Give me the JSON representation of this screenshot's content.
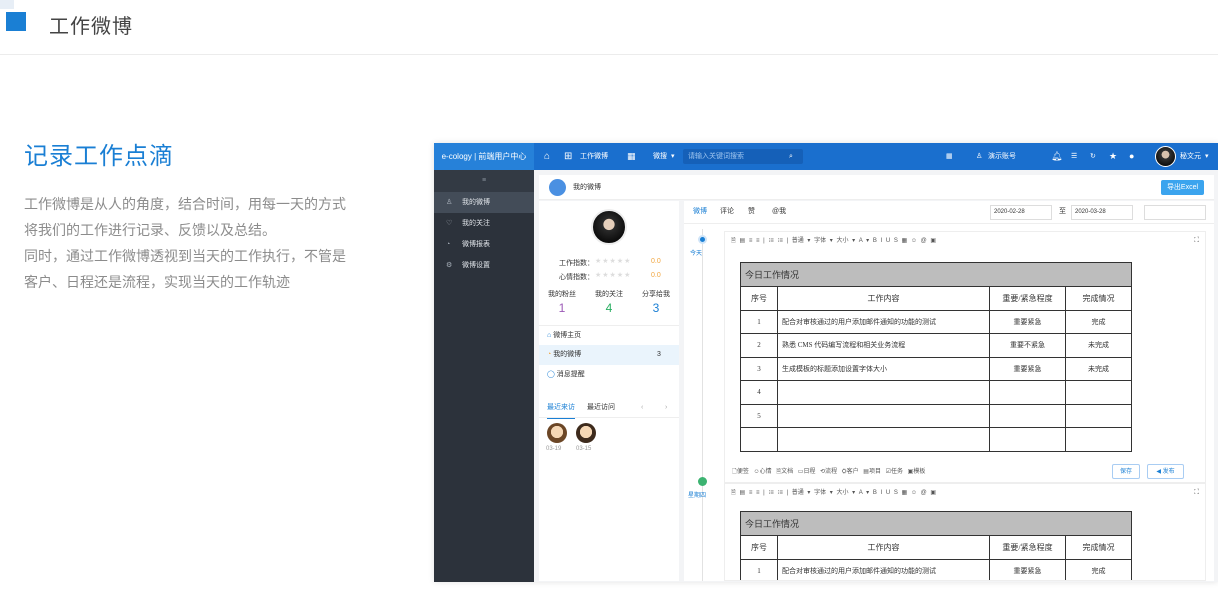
{
  "header": {
    "title": "工作微博"
  },
  "intro": {
    "heading": "记录工作点滴",
    "lines": [
      "工作微博是从人的角度，结合时间，用每一天的方式",
      "将我们的工作进行记录、反馈以及总结。",
      "同时，通过工作微博透视到当天的工作执行，不管是",
      "客户、日程还是流程，实现当天的工作轨迹"
    ]
  },
  "app": {
    "brand": "e-cology | 前端用户中心",
    "module": "工作微博",
    "search_scope": "微搜",
    "search_placeholder": "请输入关键词搜索",
    "demo_account": "演示账号",
    "user": "秘文元",
    "nav": {
      "menu_icon": "≡",
      "items": [
        "我的微博",
        "我的关注",
        "微博报表",
        "微博设置"
      ]
    },
    "page_title": "我的微博",
    "export_btn": "导出Excel",
    "profile": {
      "work_index": "工作指数：",
      "mood_index": "心情指数：",
      "stars": "★★★★★",
      "work_score": "0.0",
      "mood_score": "0.0",
      "stats": [
        {
          "label": "我的粉丝",
          "value": "1",
          "color": "#9b59b6"
        },
        {
          "label": "我的关注",
          "value": "4",
          "color": "#27ae60"
        },
        {
          "label": "分享给我",
          "value": "3",
          "color": "#1a7fd4"
        }
      ],
      "menu": [
        {
          "label": "微博主页",
          "count": ""
        },
        {
          "label": "我的微博",
          "count": "3"
        },
        {
          "label": "消息提醒",
          "count": ""
        }
      ],
      "tabs": [
        "最近来访",
        "最近访问"
      ],
      "visitors": [
        "03-19",
        "03-15"
      ]
    },
    "timeline": {
      "tabs": [
        "微博",
        "评论",
        "赞",
        "@我"
      ],
      "date_from": "2020-02-28",
      "date_to": "2020-03-28",
      "to_label": "至",
      "day1": "今天",
      "day2": "星期四"
    },
    "editor": {
      "toolbar": "🗎 ▤ ≡ ≡ | ⁝≡ ⁝≡ | 普通 ▾ 字体 ▾ 大小 ▾ A ▾ B I U S ▦ ☺ @ ▣",
      "attachments": "🗋便签 ☺心情 🗎文档 ▭日程 ⟲流程 ⛭客户 ▤项目 ☑任务 ▣模板",
      "save": "保存",
      "publish": "◀ 发布",
      "table_title": "今日工作情况",
      "columns": [
        "序号",
        "工作内容",
        "重要/紧急程度",
        "完成情况"
      ],
      "rows": [
        [
          "1",
          "配合对审核通过的用户添加邮件通知的功能的测试",
          "重要紧急",
          "完成"
        ],
        [
          "2",
          "熟悉 CMS 代码编写流程和相关业务流程",
          "重要不紧急",
          "未完成"
        ],
        [
          "3",
          "生成模板的标题添加设置字体大小",
          "重要紧急",
          "未完成"
        ],
        [
          "4",
          "",
          "",
          ""
        ],
        [
          "5",
          "",
          "",
          ""
        ]
      ]
    }
  },
  "colors": {
    "accent": "#1a7fd4",
    "header": "#1a6fce",
    "sidebar": "#2c323b"
  }
}
